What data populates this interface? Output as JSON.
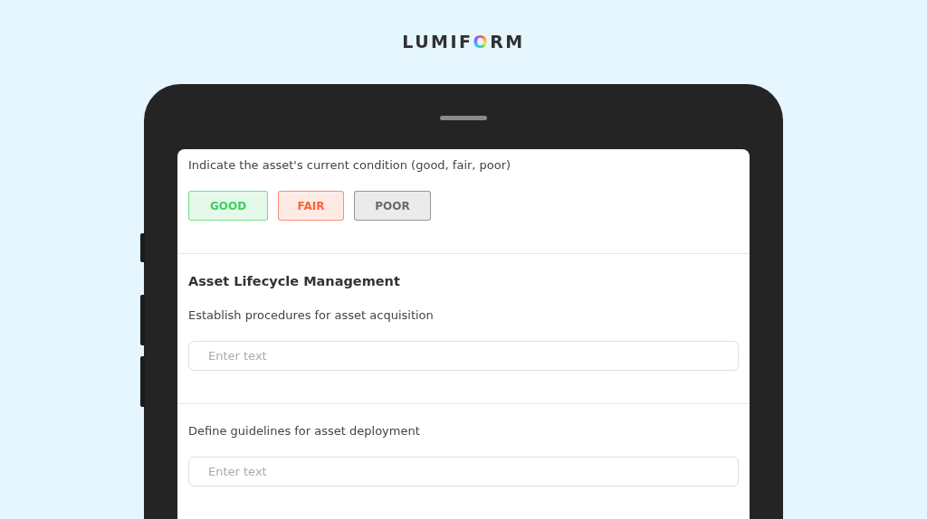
{
  "logo": {
    "text": "LUMIFORM"
  },
  "form": {
    "condition_question": {
      "label": "Indicate the asset's current condition (good, fair, poor)",
      "options": [
        {
          "label": "GOOD",
          "color": "#3fcf5f"
        },
        {
          "label": "FAIR",
          "color": "#f7643c"
        },
        {
          "label": "POOR",
          "color": "#6b6b6b"
        }
      ]
    },
    "section": {
      "title": "Asset Lifecycle Management",
      "questions": [
        {
          "label": "Establish procedures for asset acquisition",
          "placeholder": "Enter text"
        },
        {
          "label": "Define guidelines for asset deployment",
          "placeholder": "Enter text"
        }
      ]
    }
  }
}
